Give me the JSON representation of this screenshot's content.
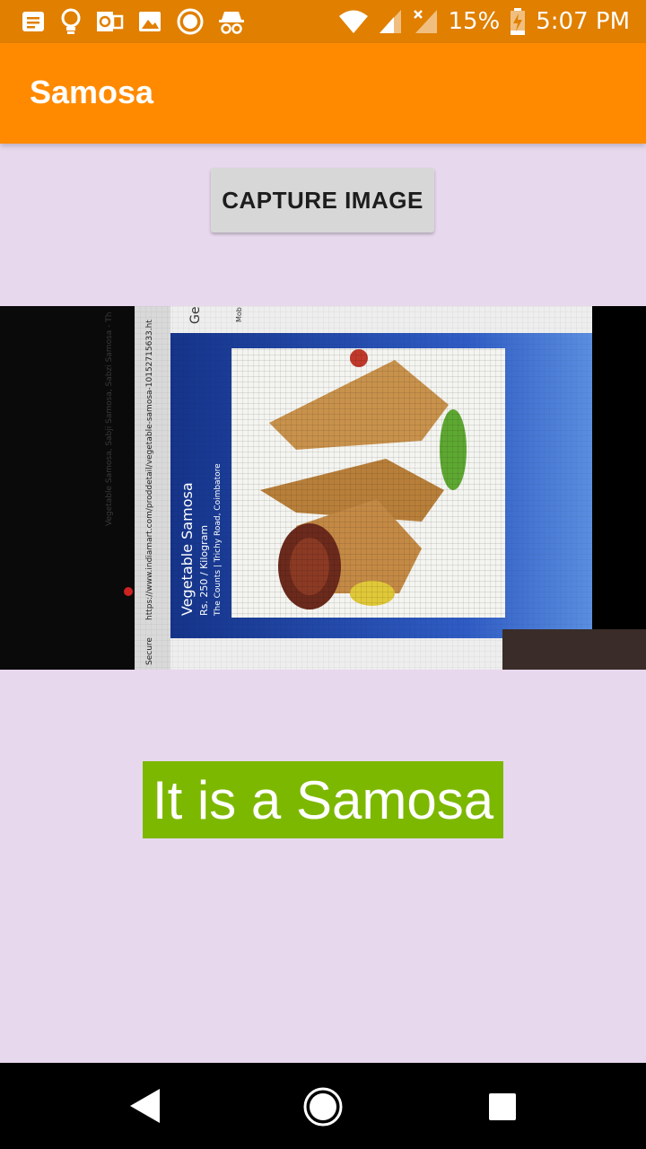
{
  "status_bar": {
    "battery": "15%",
    "time": "5:07 PM",
    "icons": [
      "notes-icon",
      "lightbulb-icon",
      "outlook-icon",
      "image-icon",
      "record-icon",
      "incognito-icon",
      "wifi-icon",
      "signal-icon",
      "no-signal-icon",
      "battery-charging-icon"
    ]
  },
  "app_bar": {
    "title": "Samosa",
    "color": "#ff8a00"
  },
  "capture": {
    "label": "CAPTURE IMAGE"
  },
  "photo": {
    "text_lines": [
      "Vegetable Samosa",
      "Rs. 250 / Kilogram",
      "The Counts   | Trichy Road,  Coimbatore",
      "https://www.indiamart.com/proddetail/vegetable-samosa-10152715633.ht",
      "Secure",
      "Vegetable Samosa, Sabji Samosa, Sabzi Samosa - Th",
      "Ge",
      "Mob"
    ]
  },
  "result": {
    "text": "It is a Samosa",
    "color": "#7db800"
  },
  "nav_bar": {
    "icons": [
      "back-icon",
      "home-icon",
      "recents-icon"
    ]
  }
}
